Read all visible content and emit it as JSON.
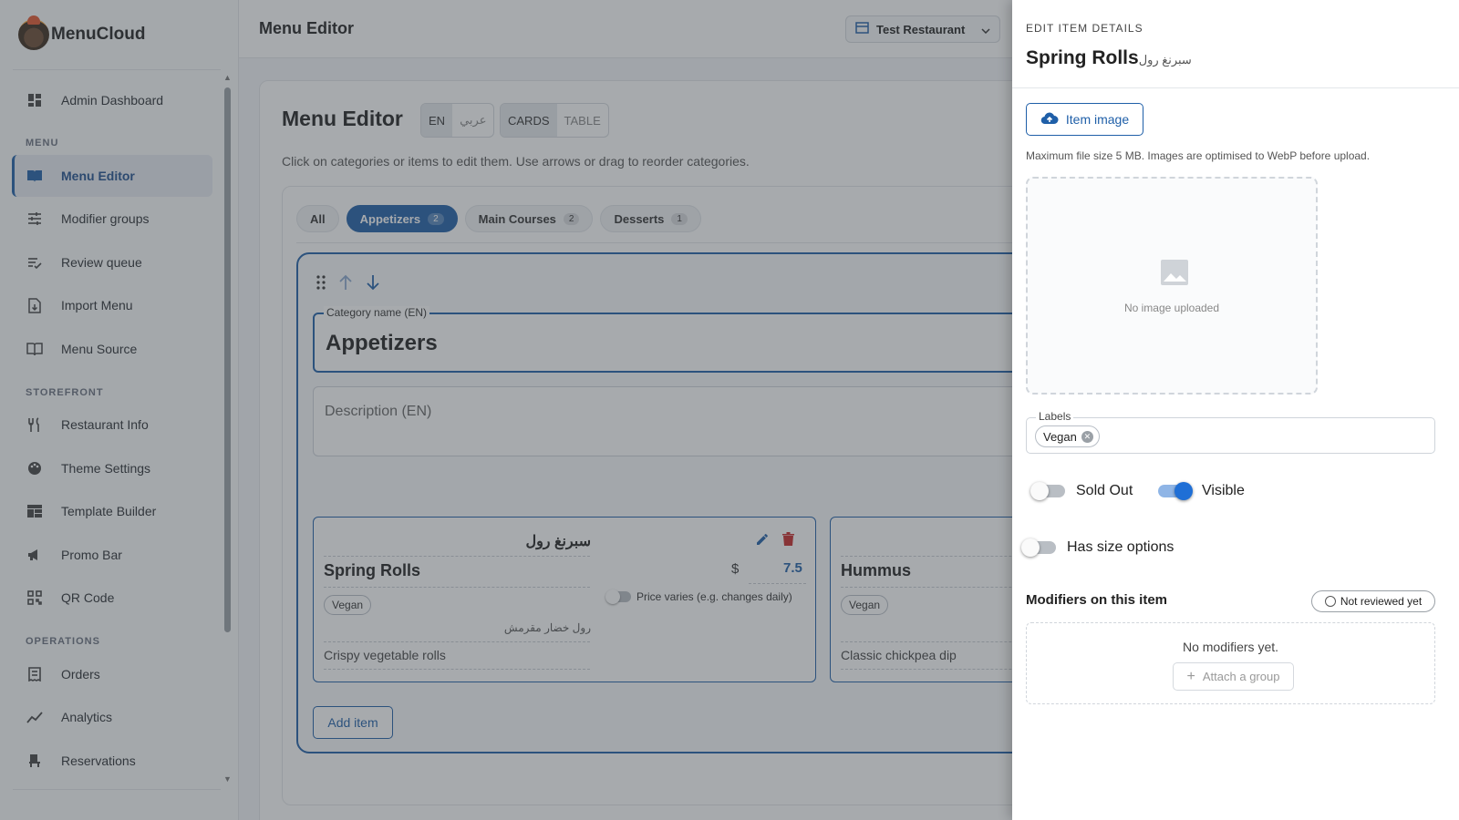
{
  "app": {
    "name": "MenuCloud"
  },
  "sidebar": {
    "items_top": [
      {
        "label": "Admin Dashboard",
        "icon": "dashboard-icon"
      }
    ],
    "sections": [
      {
        "title": "MENU",
        "items": [
          {
            "label": "Menu Editor",
            "icon": "book-icon",
            "active": true
          },
          {
            "label": "Modifier groups",
            "icon": "tune-icon"
          },
          {
            "label": "Review queue",
            "icon": "playlist-check-icon"
          },
          {
            "label": "Import Menu",
            "icon": "file-import-icon"
          },
          {
            "label": "Menu Source",
            "icon": "menu-book-icon"
          }
        ]
      },
      {
        "title": "STOREFRONT",
        "items": [
          {
            "label": "Restaurant Info",
            "icon": "restaurant-icon"
          },
          {
            "label": "Theme Settings",
            "icon": "palette-icon"
          },
          {
            "label": "Template Builder",
            "icon": "grid-icon"
          },
          {
            "label": "Promo Bar",
            "icon": "megaphone-icon"
          },
          {
            "label": "QR Code",
            "icon": "qr-code-icon"
          }
        ]
      },
      {
        "title": "OPERATIONS",
        "items": [
          {
            "label": "Orders",
            "icon": "receipt-icon"
          },
          {
            "label": "Analytics",
            "icon": "trend-icon"
          },
          {
            "label": "Reservations",
            "icon": "table-icon"
          }
        ]
      }
    ]
  },
  "topbar": {
    "title": "Menu Editor",
    "restaurant": "Test Restaurant"
  },
  "editor": {
    "title": "Menu Editor",
    "lang_en": "EN",
    "lang_ar": "عربي",
    "view_cards": "CARDS",
    "view_table": "TABLE",
    "hint": "Click on categories or items to edit them. Use arrows or drag to reorder categories.",
    "tabs": [
      {
        "label": "All",
        "count": ""
      },
      {
        "label": "Appetizers",
        "count": "2",
        "active": true
      },
      {
        "label": "Main Courses",
        "count": "2"
      },
      {
        "label": "Desserts",
        "count": "1"
      }
    ],
    "category": {
      "name_label": "Category name (EN)",
      "name": "Appetizers",
      "description_placeholder": "Description (EN)"
    },
    "items": [
      {
        "name_ar": "سبرنغ رول",
        "name": "Spring Rolls",
        "tag": "Vegan",
        "desc_ar": "رول خضار مقرمش",
        "desc": "Crispy vegetable rolls",
        "currency": "$",
        "price": "7.5",
        "price_varies": "Price varies (e.g. changes daily)"
      },
      {
        "name": "Hummus",
        "tag": "Vegan",
        "desc": "Classic chickpea dip"
      }
    ],
    "add_item": "Add item"
  },
  "drawer": {
    "eyebrow": "EDIT ITEM DETAILS",
    "title_en": "Spring Rolls",
    "title_ar": "سبرنغ رول",
    "image_button": "Item image",
    "image_hint": "Maximum file size 5 MB. Images are optimised to WebP before upload.",
    "no_image": "No image uploaded",
    "labels_label": "Labels",
    "label_chip": "Vegan",
    "sold_out": "Sold Out",
    "visible": "Visible",
    "size_options": "Has size options",
    "modifiers_title": "Modifiers on this item",
    "review_status": "Not reviewed yet",
    "no_modifiers": "No modifiers yet.",
    "attach": "Attach a group"
  },
  "colors": {
    "accent": "#1f5fa8",
    "toggle_on": "#1f6fd6",
    "delete": "#c62828"
  }
}
